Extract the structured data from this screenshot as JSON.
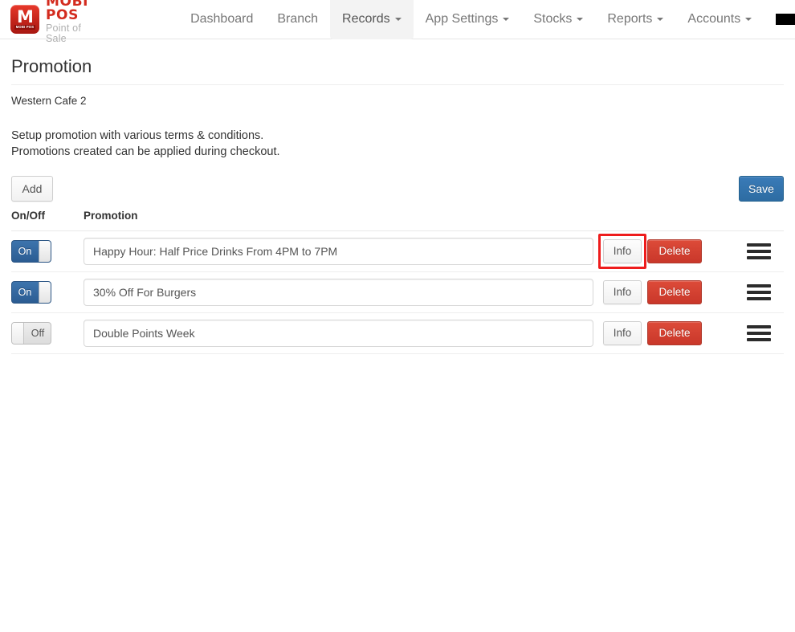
{
  "brand": {
    "mark_glyph": "M",
    "mark_sub": "MOBI POS",
    "title": "MOBI POS",
    "subtitle": "Point of Sale",
    "color": "#d32b1e"
  },
  "nav": {
    "items": [
      {
        "label": "Dashboard",
        "caret": false,
        "active": false
      },
      {
        "label": "Branch",
        "caret": false,
        "active": false
      },
      {
        "label": "Records",
        "caret": true,
        "active": true
      },
      {
        "label": "App Settings",
        "caret": true,
        "active": false
      },
      {
        "label": "Stocks",
        "caret": true,
        "active": false
      },
      {
        "label": "Reports",
        "caret": true,
        "active": false
      },
      {
        "label": "Accounts",
        "caret": true,
        "active": false
      }
    ],
    "account_menu": {
      "label": "",
      "redacted": true,
      "caret": true
    }
  },
  "page": {
    "title": "Promotion",
    "branch": "Western Cafe 2",
    "description_line1": "Setup promotion with various terms & conditions.",
    "description_line2": "Promotions created can be applied during checkout."
  },
  "toolbar": {
    "add_label": "Add",
    "save_label": "Save",
    "save_color": "#2d6ca2"
  },
  "table": {
    "headers": {
      "onoff": "On/Off",
      "promotion": "Promotion"
    },
    "rows": [
      {
        "toggle_state": "On",
        "toggle_on": true,
        "promotion": "Happy Hour: Half Price Drinks From 4PM to 7PM",
        "info_label": "Info",
        "delete_label": "Delete",
        "highlighted": true
      },
      {
        "toggle_state": "On",
        "toggle_on": true,
        "promotion": "30% Off For Burgers",
        "info_label": "Info",
        "delete_label": "Delete",
        "highlighted": false
      },
      {
        "toggle_state": "Off",
        "toggle_on": false,
        "promotion": "Double Points Week",
        "info_label": "Info",
        "delete_label": "Delete",
        "highlighted": false
      }
    ]
  },
  "annotation": {
    "highlight_color": "#ee1c1c",
    "target": "info-button-row-1"
  }
}
